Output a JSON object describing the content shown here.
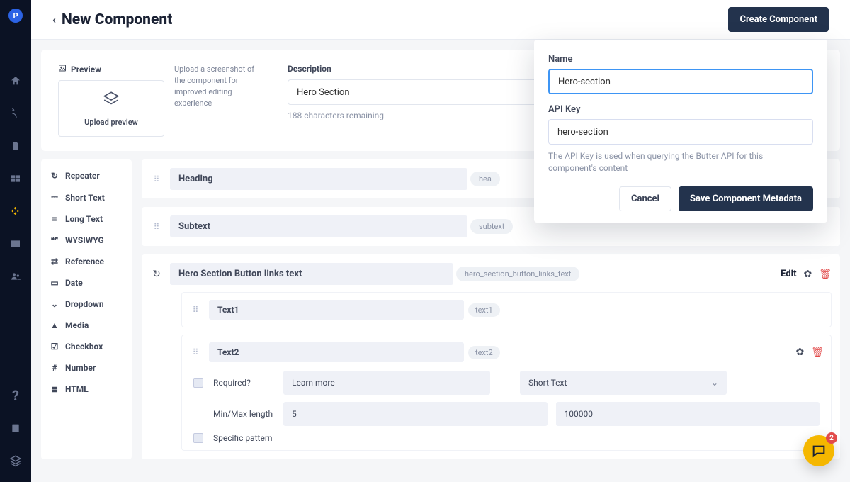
{
  "leftnav": {
    "avatar_initial": "P"
  },
  "header": {
    "page_title": "New Component",
    "create_button": "Create Component"
  },
  "top_card": {
    "preview_label": "Preview",
    "upload_caption": "Upload preview",
    "upload_hint": "Upload a screenshot of the component for improved editing experience",
    "description_label": "Description",
    "description_value": "Hero Section",
    "description_remaining": "188 characters remaining"
  },
  "modal": {
    "name_label": "Name",
    "name_value": "Hero-section",
    "apikey_label": "API Key",
    "apikey_value": "hero-section",
    "help_text": "The API Key is used when querying the Butter API for this component's content",
    "cancel": "Cancel",
    "save": "Save Component Metadata"
  },
  "palette": [
    {
      "icon": "↻",
      "label": "Repeater"
    },
    {
      "icon": "⎓",
      "label": "Short Text"
    },
    {
      "icon": "≡",
      "label": "Long Text"
    },
    {
      "icon": "❝❞",
      "label": "WYSIWYG"
    },
    {
      "icon": "⇄",
      "label": "Reference"
    },
    {
      "icon": "▭",
      "label": "Date"
    },
    {
      "icon": "⌄",
      "label": "Dropdown"
    },
    {
      "icon": "▲",
      "label": "Media"
    },
    {
      "icon": "☑",
      "label": "Checkbox"
    },
    {
      "icon": "#",
      "label": "Number"
    },
    {
      "icon": "≣",
      "label": "HTML"
    }
  ],
  "fields": {
    "row1": {
      "name": "Heading",
      "slug": "hea"
    },
    "row2": {
      "name": "Subtext",
      "slug": "subtext"
    },
    "repeater": {
      "name": "Hero Section Button links text",
      "slug": "hero_section_button_links_text",
      "edit_label": "Edit",
      "child1": {
        "name": "Text1",
        "slug": "text1"
      },
      "child2": {
        "name": "Text2",
        "slug": "text2",
        "cfg": {
          "required_label": "Required?",
          "placeholder_value": "Learn more",
          "type_value": "Short Text",
          "minmax_label": "Min/Max length",
          "min_value": "5",
          "max_value": "100000",
          "pattern_label": "Specific pattern"
        }
      }
    }
  },
  "chat": {
    "badge": "2"
  }
}
